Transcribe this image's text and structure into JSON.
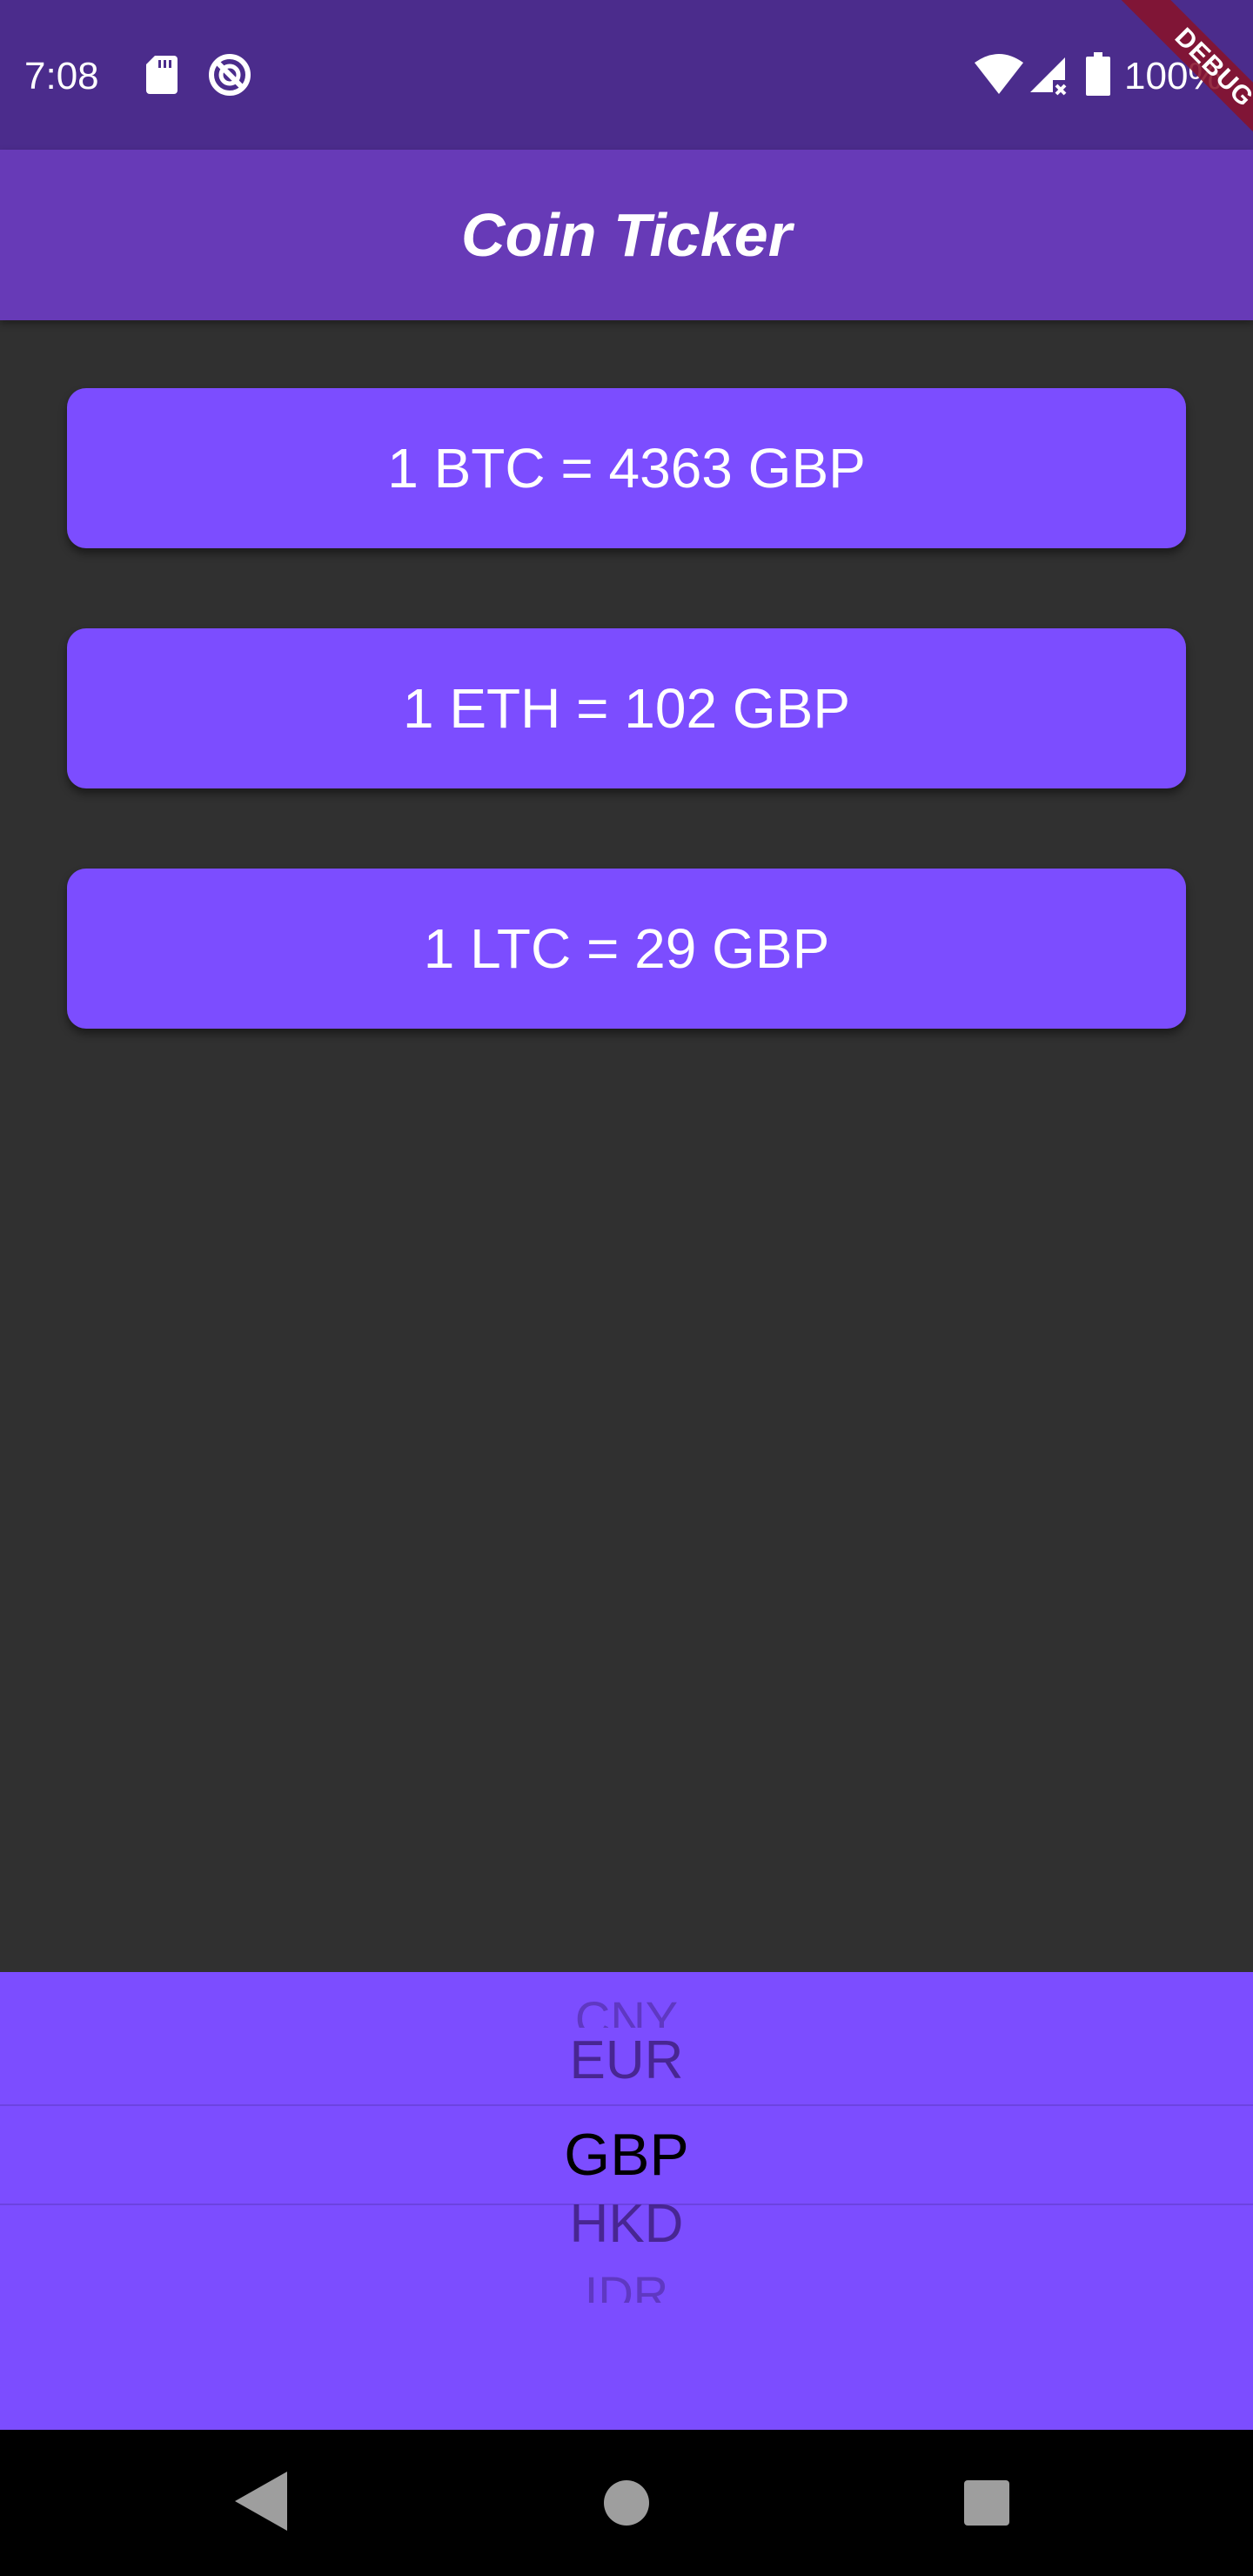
{
  "status_bar": {
    "time": "7:08",
    "battery": "100%",
    "debug_banner": "DEBUG",
    "icons": [
      "sd-card-icon",
      "sync-off-icon",
      "wifi-icon",
      "signal-icon",
      "battery-icon"
    ]
  },
  "app_bar": {
    "title": "Coin Ticker"
  },
  "rates": [
    {
      "text": "1 BTC = 4363 GBP"
    },
    {
      "text": "1 ETH = 102 GBP"
    },
    {
      "text": "1 LTC = 29 GBP"
    }
  ],
  "picker": {
    "items": [
      "CNY",
      "EUR",
      "GBP",
      "HKD",
      "IDR"
    ],
    "selected": "GBP"
  },
  "nav_bar": {
    "icons": [
      "back-icon",
      "home-icon",
      "recents-icon"
    ]
  },
  "colors": {
    "status_bar": "#4b2c8c",
    "app_bar": "#673ab7",
    "card": "#7c4dff",
    "background": "#303030"
  }
}
